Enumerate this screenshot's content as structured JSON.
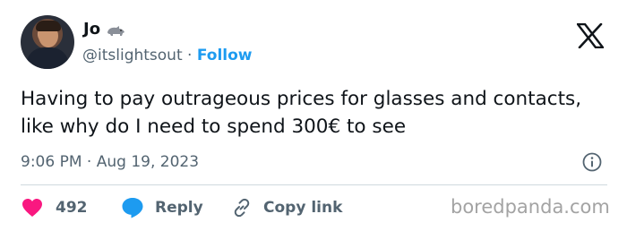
{
  "user": {
    "name": "Jo",
    "handle": "@itslightsout",
    "separator": "·",
    "follow_label": "Follow",
    "badge_icon": "rhino-emoji-icon"
  },
  "tweet": {
    "text": "Having to pay outrageous prices for glasses and contacts, like why do I need to spend 300€ to see",
    "time": "9:06 PM",
    "separator": "·",
    "date": "Aug 19, 2023"
  },
  "actions": {
    "likes_count": "492",
    "reply_label": "Reply",
    "copy_link_label": "Copy link"
  },
  "watermark": "boredpanda.com",
  "colors": {
    "accent": "#1d9bf0",
    "like": "#f91880",
    "muted": "#536471",
    "text": "#0f1419"
  }
}
